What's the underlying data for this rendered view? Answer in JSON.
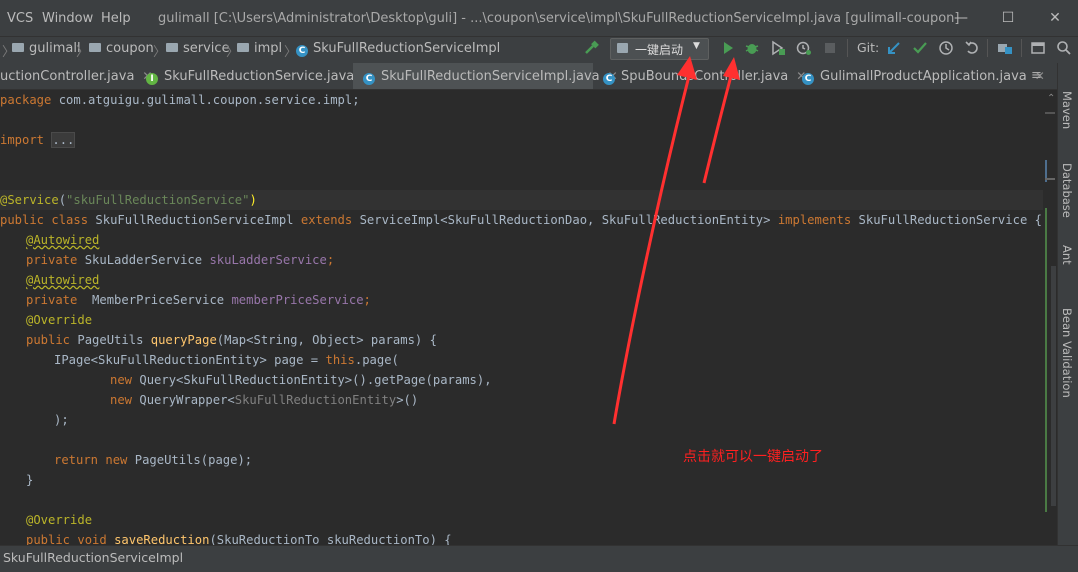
{
  "menu": {
    "vcs": "VCS",
    "window": "Window",
    "help": "Help"
  },
  "window_title": "gulimall [C:\\Users\\Administrator\\Desktop\\guli] - ...\\coupon\\service\\impl\\SkuFullReductionServiceImpl.java [gulimall-coupon]",
  "window_controls": {
    "minimize": "—",
    "maximize": "☐",
    "close": "✕"
  },
  "breadcrumb": [
    "gulimall",
    "coupon",
    "service",
    "impl",
    "SkuFullReductionServiceImpl"
  ],
  "toolbar": {
    "run_config": "一键启动",
    "git_label": "Git:",
    "icons": [
      "build-icon",
      "run-icon",
      "debug-icon",
      "coverage-icon",
      "profile-icon",
      "stop-icon",
      "vcs-update-icon",
      "vcs-commit-icon",
      "history-icon",
      "revert-icon",
      "project-structure-icon",
      "layout-icon",
      "search-icon"
    ]
  },
  "tabs": [
    {
      "label": "uctionController.java",
      "type": "class",
      "active": false
    },
    {
      "label": "SkuFullReductionService.java",
      "type": "interface",
      "active": false
    },
    {
      "label": "SkuFullReductionServiceImpl.java",
      "type": "class",
      "active": true
    },
    {
      "label": "SpuBoundsController.java",
      "type": "class",
      "active": false
    },
    {
      "label": "GulimallProductApplication.java",
      "type": "class",
      "active": false
    }
  ],
  "tab_overflow": "≡",
  "code": {
    "package_kw": "package",
    "package_name": " com.atguigu.gulimall.coupon.service.impl;",
    "import_kw": "import",
    "import_fold": "...",
    "service_ann": "@Service",
    "service_open": "(",
    "service_str": "\"skuFullReductionService\"",
    "service_close": ")",
    "class_line": {
      "kw1": "public class",
      "name": " SkuFullReductionServiceImpl ",
      "kw2": "extends",
      "mid": " ServiceImpl<SkuFullReductionDao, SkuFullReductionEntity> ",
      "kw3": "implements",
      "end": " SkuFullReductionService {"
    },
    "autowired": "@Autowired",
    "private_kw": "private",
    "field1_type": " SkuLadderService ",
    "field1_name": "skuLadderService",
    "field2_type": "  MemberPriceService ",
    "field2_name": "memberPriceService",
    "semicolon": ";",
    "override": "@Override",
    "public_kw": "public",
    "qp_ret": " PageUtils ",
    "qp_name": "queryPage",
    "qp_params": "(Map<String, Object> params) {",
    "ipage_decl": "IPage<SkuFullReductionEntity> page = ",
    "this_kw": "this",
    "page_call": ".page(",
    "new_kw": "new",
    "query_line": " Query<SkuFullReductionEntity>().getPage(params),",
    "qw_class": " QueryWrapper<",
    "qw_gen": "SkuFullReductionEntity",
    "qw_end": ">()",
    "close_paren": ");",
    "return_kw": "return",
    "return_rest": " PageUtils(page);",
    "close_brace": "}",
    "void_kw": "public void",
    "save_name": "saveReduction",
    "save_params": "(SkuReductionTo skuReductionTo) {"
  },
  "right_tools": [
    "Maven",
    "Database",
    "Ant",
    "Bean Validation"
  ],
  "status_text": "SkuFullReductionServiceImpl",
  "annotation_note": "点击就可以一键启动了",
  "colors": {
    "arrow": "#ff3030",
    "run_green": "#499c54",
    "keyword": "#cc7832",
    "annotation": "#bbb529",
    "string": "#6a8759",
    "field": "#9876aa",
    "method": "#ffc66d"
  }
}
